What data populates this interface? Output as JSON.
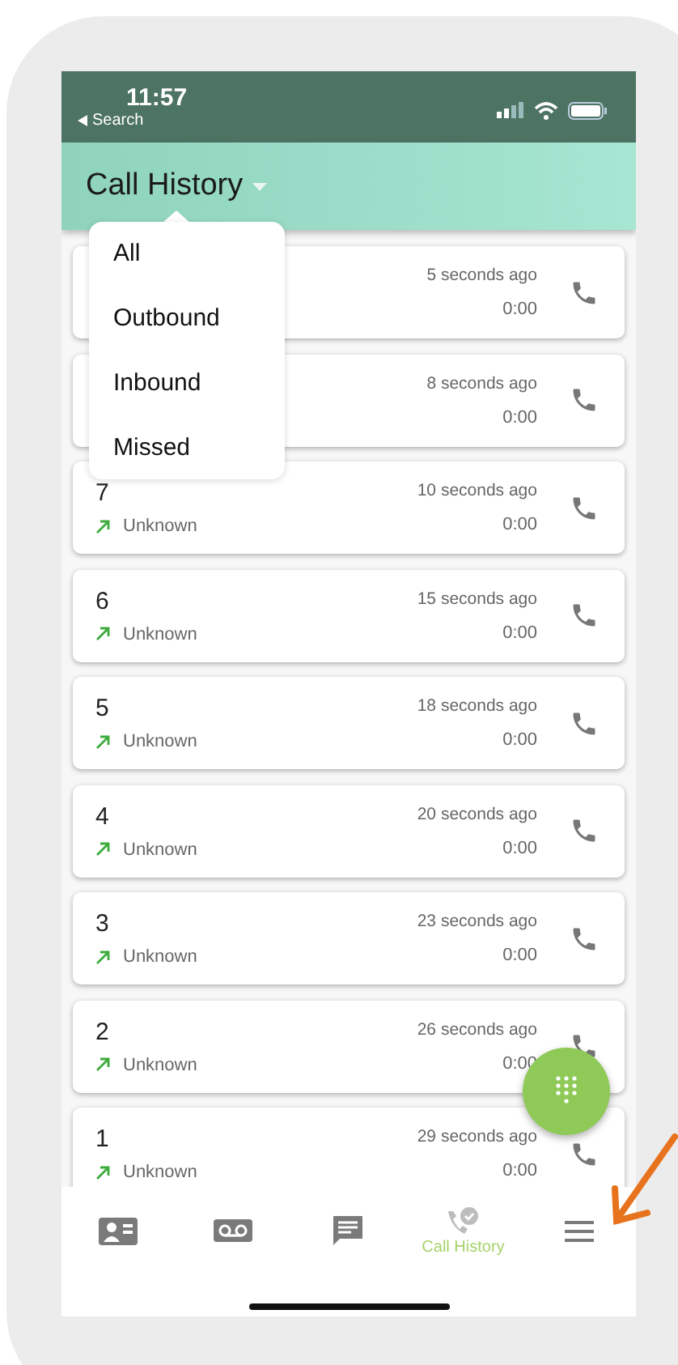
{
  "status_bar": {
    "time": "11:57",
    "back": "Search"
  },
  "header": {
    "title": "Call History"
  },
  "filter_menu": [
    {
      "label": "All",
      "selected": false
    },
    {
      "label": "Outbound",
      "selected": false
    },
    {
      "label": "Inbound",
      "selected": false
    },
    {
      "label": "Missed",
      "selected": false
    }
  ],
  "calls": [
    {
      "time": "5 seconds ago",
      "duration": "0:00"
    },
    {
      "time": "8 seconds ago",
      "duration": "0:00"
    },
    {
      "name": "7",
      "caller": "Unknown",
      "kind": "outbound",
      "time": "10 seconds ago",
      "duration": "0:00"
    },
    {
      "name": "6",
      "caller": "Unknown",
      "kind": "outbound",
      "time": "15 seconds ago",
      "duration": "0:00"
    },
    {
      "name": "5",
      "caller": "Unknown",
      "kind": "outbound",
      "time": "18 seconds ago",
      "duration": "0:00"
    },
    {
      "name": "4",
      "caller": "Unknown",
      "kind": "outbound",
      "time": "20 seconds ago",
      "duration": "0:00"
    },
    {
      "name": "3",
      "caller": "Unknown",
      "kind": "outbound",
      "time": "23 seconds ago",
      "duration": "0:00"
    },
    {
      "name": "2",
      "caller": "Unknown",
      "kind": "outbound",
      "time": "26 seconds ago",
      "duration": "0:00"
    },
    {
      "name": "1",
      "caller": "Unknown",
      "kind": "outbound",
      "time": "29 seconds ago",
      "duration": "0:00"
    }
  ],
  "tab_bar": [
    {
      "kind": "contacts",
      "selected": false
    },
    {
      "kind": "voicemail",
      "selected": false
    },
    {
      "kind": "messages",
      "selected": false
    },
    {
      "kind": "history",
      "label": "Call History",
      "selected": true
    },
    {
      "kind": "menu",
      "selected": false
    }
  ]
}
